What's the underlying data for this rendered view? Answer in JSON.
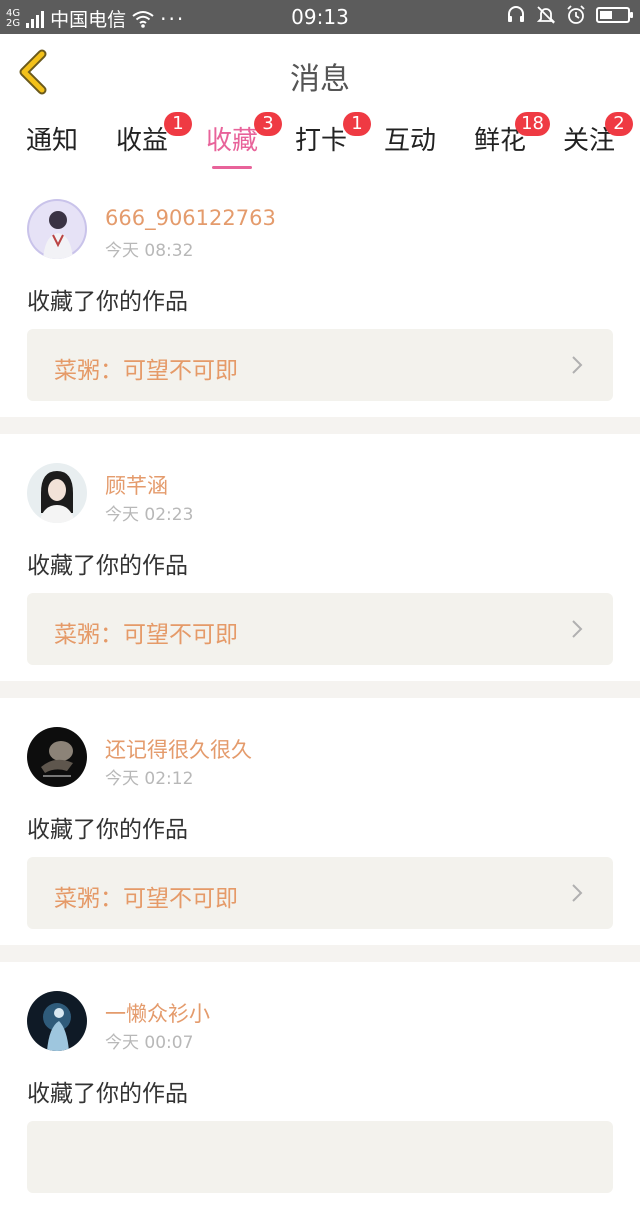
{
  "statusbar": {
    "network_top": "4G",
    "network_bottom": "2G",
    "carrier": "中国电信",
    "dots": "···",
    "time": "09:13",
    "battery_level": 0.45
  },
  "header": {
    "title": "消息"
  },
  "tabs": [
    {
      "label": "通知",
      "badge": ""
    },
    {
      "label": "收益",
      "badge": "1"
    },
    {
      "label": "收藏",
      "badge": "3",
      "active": true
    },
    {
      "label": "打卡",
      "badge": "1"
    },
    {
      "label": "互动",
      "badge": ""
    },
    {
      "label": "鲜花",
      "badge": "18"
    },
    {
      "label": "关注",
      "badge": "2"
    }
  ],
  "messages": [
    {
      "username": "666_906122763",
      "time": "今天 08:32",
      "action": "收藏了你的作品",
      "work": "菜粥：可望不可即"
    },
    {
      "username": "顾芊涵",
      "time": "今天 02:23",
      "action": "收藏了你的作品",
      "work": "菜粥：可望不可即"
    },
    {
      "username": "还记得很久很久",
      "time": "今天 02:12",
      "action": "收藏了你的作品",
      "work": "菜粥：可望不可即"
    },
    {
      "username": "一懒众衫小",
      "time": "今天 00:07",
      "action": "收藏了你的作品",
      "work": ""
    }
  ],
  "colors": {
    "accent": "#e8639a",
    "badge": "#ef3a43",
    "username": "#e49b6c",
    "work_title": "#e59a68",
    "back_icon": "#f3c11a"
  }
}
